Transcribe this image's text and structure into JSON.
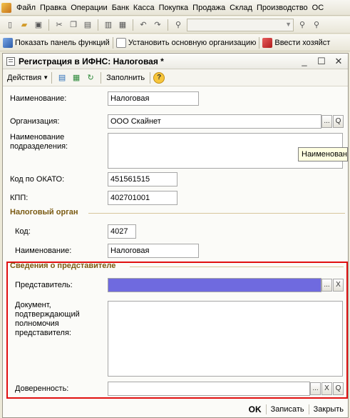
{
  "menu": {
    "items": [
      "Файл",
      "Правка",
      "Операции",
      "Банк",
      "Касса",
      "Покупка",
      "Продажа",
      "Склад",
      "Производство",
      "ОС"
    ]
  },
  "toolbar2": {
    "show_panel": "Показать панель функций",
    "set_org": "Установить основную организацию",
    "enter_info": "Ввести хозяйст"
  },
  "window": {
    "title": "Регистрация в ИФНС: Налоговая *"
  },
  "actionbar": {
    "actions": "Действия",
    "fill": "Заполнить",
    "help": "?"
  },
  "form": {
    "name_label": "Наименование:",
    "name_value": "Налоговая",
    "org_label": "Организация:",
    "org_value": "ООО Скайнет",
    "division_label": "Наименование подразделения:",
    "division_value": "",
    "tooltip": "Наименование",
    "okato_label": "Код по ОКАТО:",
    "okato_value": "451561515",
    "kpp_label": "КПП:",
    "kpp_value": "402701001",
    "tax_section": "Налоговый орган",
    "code_label": "Код:",
    "code_value": "4027",
    "tax_name_label": "Наименование:",
    "tax_name_value": "Налоговая",
    "rep_section": "Сведения о представителе",
    "rep_label": "Представитель:",
    "rep_value": "",
    "doc_label": "Документ, подтверждающий полномочия представителя:",
    "doc_value": "",
    "proxy_label": "Доверенность:",
    "proxy_value": ""
  },
  "buttons": {
    "ellipsis": "...",
    "search": "Q",
    "clear": "X",
    "ok": "OK",
    "save": "Записать",
    "close": "Закрыть"
  },
  "colors": {
    "highlight_border": "#e01010",
    "representative_fill": "#6f6adf"
  }
}
